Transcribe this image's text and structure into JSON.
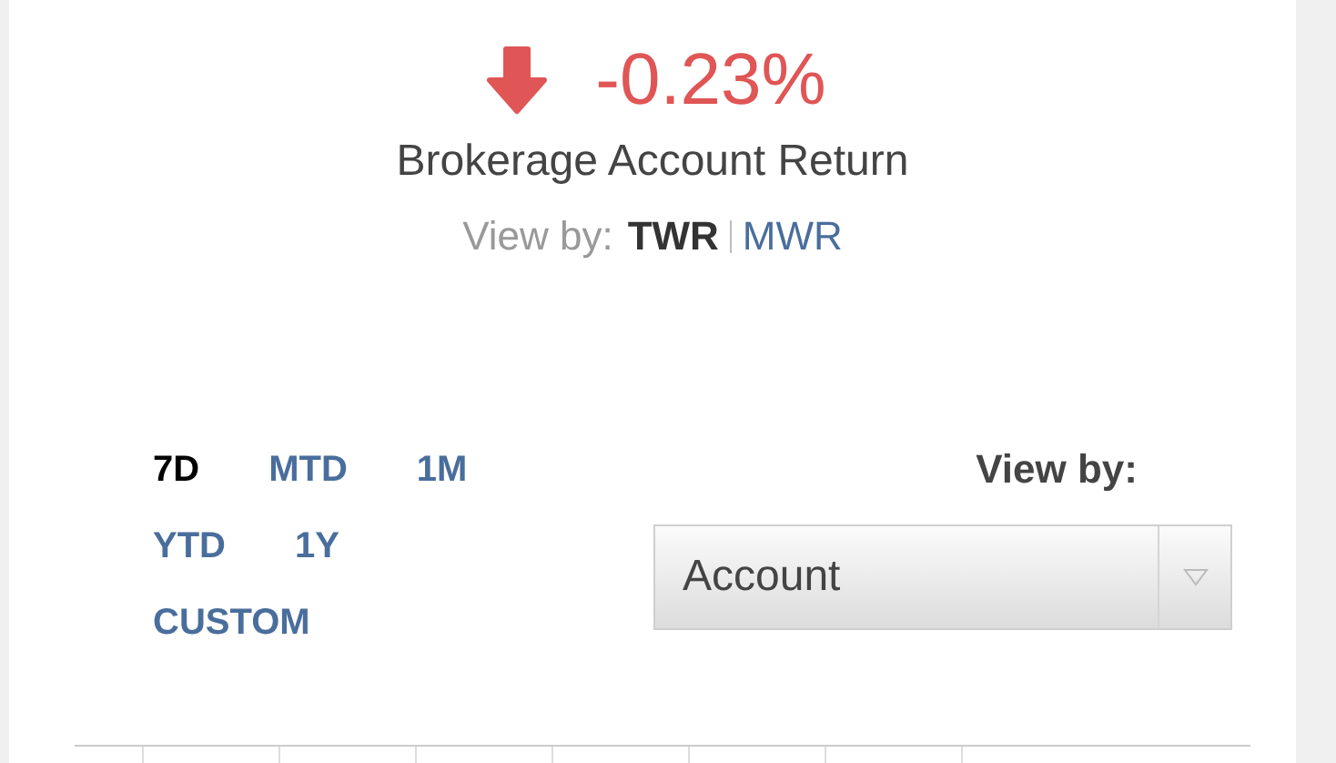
{
  "return_summary": {
    "value": "-0.23%",
    "negative": true,
    "label": "Brokerage Account Return",
    "view_by_label": "View by:",
    "methods": [
      {
        "label": "TWR",
        "selected": true
      },
      {
        "label": "MWR",
        "selected": false
      }
    ]
  },
  "periods": [
    {
      "label": "7D",
      "selected": true
    },
    {
      "label": "MTD",
      "selected": false
    },
    {
      "label": "1M",
      "selected": false
    },
    {
      "label": "YTD",
      "selected": false
    },
    {
      "label": "1Y",
      "selected": false
    },
    {
      "label": "CUSTOM",
      "selected": false
    }
  ],
  "view_by": {
    "label": "View by:",
    "value": "Account"
  }
}
